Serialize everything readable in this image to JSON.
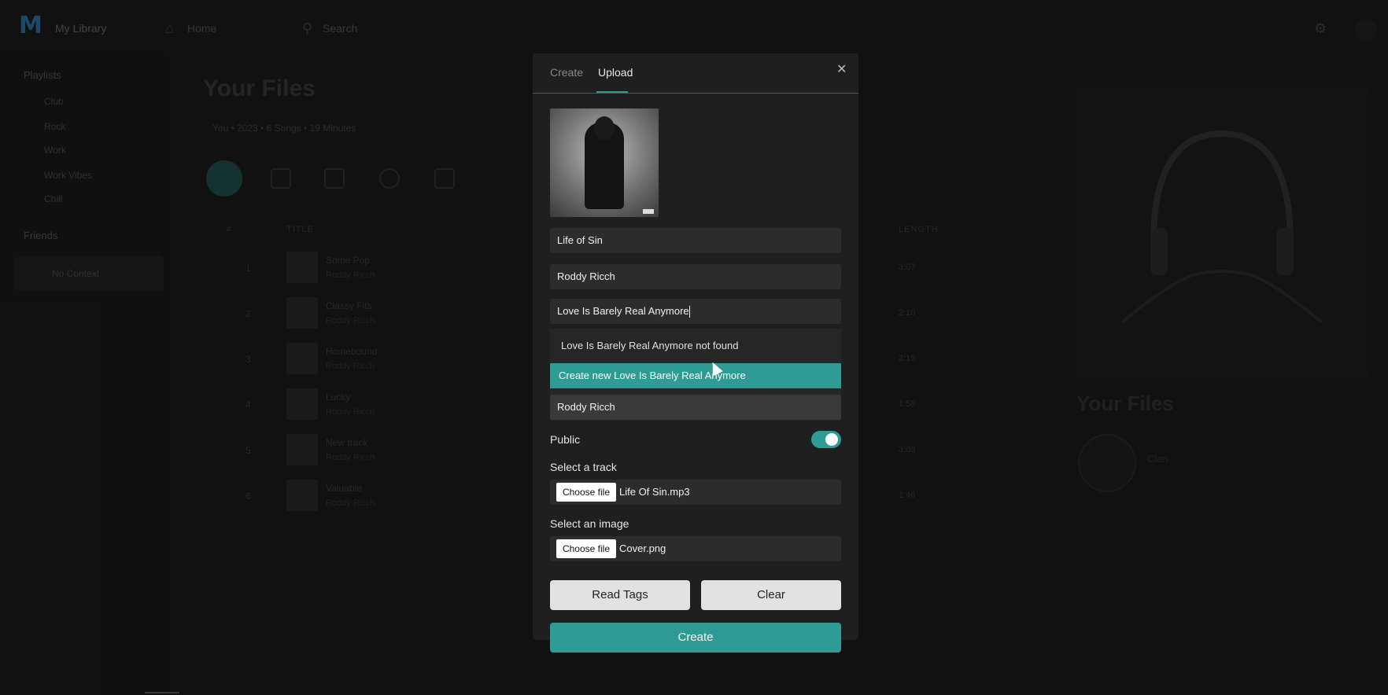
{
  "app": {
    "title": "My Library",
    "nav_home": "Home",
    "nav_search": "Search"
  },
  "sidebar": {
    "section_playlists": "Playlists",
    "items": [
      "Club",
      "Rock",
      "Work",
      "Work Vibes",
      "Chill"
    ],
    "section_friends": "Friends",
    "active_item": "No Context"
  },
  "main": {
    "page_title": "Your Files",
    "breadcrumb": "You  •  2023  •  6 Songs  •  19 Minutes",
    "columns": [
      "#",
      "TITLE",
      "LENGTH"
    ],
    "rows": [
      {
        "num": "1",
        "title": "Some Pop",
        "artist": "Roddy Ricch",
        "length": "3:07"
      },
      {
        "num": "2",
        "title": "Classy Fits",
        "artist": "Roddy Ricch",
        "length": "2:10"
      },
      {
        "num": "3",
        "title": "Homebound",
        "artist": "Roddy Ricch",
        "length": "2:15"
      },
      {
        "num": "4",
        "title": "Lucky",
        "artist": "Roddy Ricch",
        "length": "1:58"
      },
      {
        "num": "5",
        "title": "New track",
        "artist": "Roddy Ricch",
        "length": "3:03"
      },
      {
        "num": "6",
        "title": "Valuable",
        "artist": "Roddy Ricch",
        "length": "1:46"
      }
    ]
  },
  "right_panel": {
    "title": "Your Files",
    "label": "Clan"
  },
  "modal": {
    "tab_create": "Create",
    "tab_upload": "Upload",
    "close_icon": "close-icon",
    "title_value": "Life of Sin",
    "artist_value": "Roddy Ricch",
    "album_value": "Love Is Barely Real Anymore",
    "dropdown_not_found": "Love Is Barely Real Anymore not found",
    "dropdown_create": "Create new Love Is Barely Real Anymore",
    "album_artist_value": "Roddy Ricch",
    "public_label": "Public",
    "public_on": true,
    "track_label": "Select a track",
    "choose_file_label": "Choose file",
    "track_file": "Life Of Sin.mp3",
    "image_label": "Select an image",
    "image_file": "Cover.png",
    "read_tags_label": "Read Tags",
    "clear_label": "Clear",
    "create_label": "Create"
  },
  "colors": {
    "accent": "#2e9b95",
    "modal_bg": "#1f1f1f",
    "field_bg": "#2c2c2c"
  }
}
